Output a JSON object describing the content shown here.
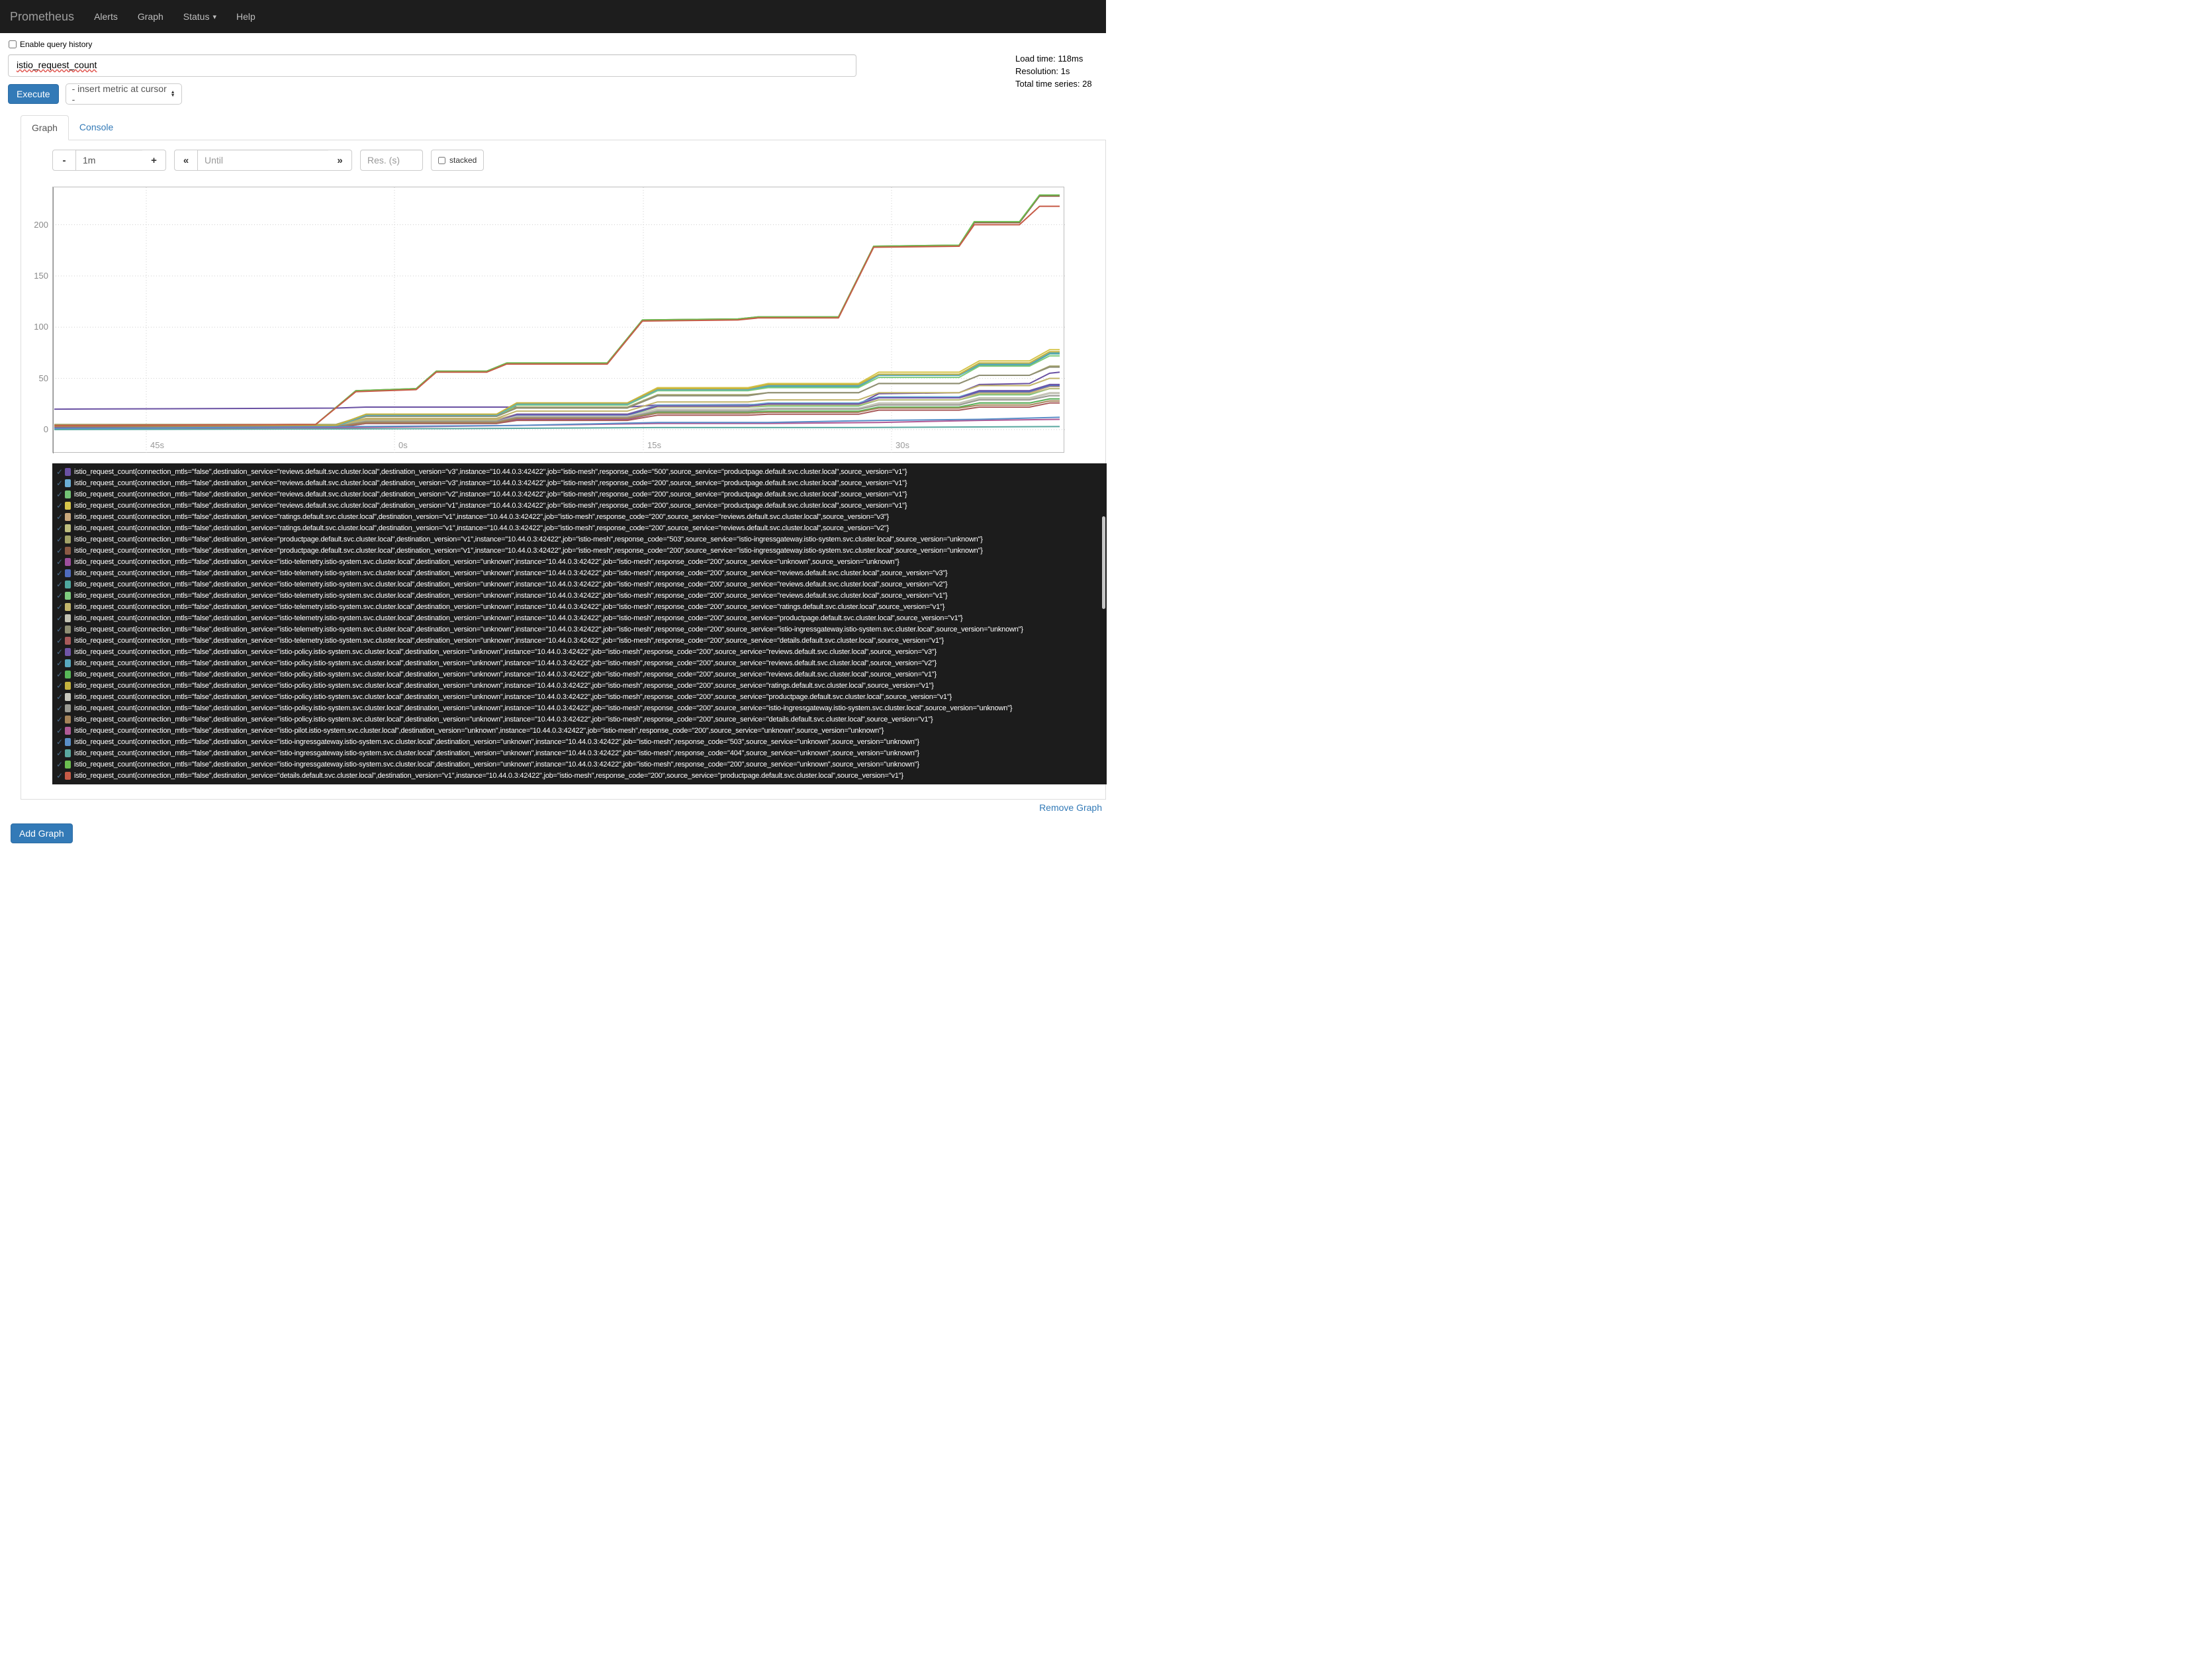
{
  "navbar": {
    "brand": "Prometheus",
    "items": [
      {
        "label": "Alerts"
      },
      {
        "label": "Graph"
      },
      {
        "label": "Status"
      },
      {
        "label": "Help"
      }
    ]
  },
  "query_history": {
    "label": "Enable query history"
  },
  "query": {
    "value": "istio_request_count"
  },
  "stats": {
    "load_time": "Load time: 118ms",
    "resolution": "Resolution: 1s",
    "total_series": "Total time series: 28"
  },
  "actions": {
    "execute": "Execute",
    "insert_metric": "- insert metric at cursor -"
  },
  "tabs": [
    {
      "label": "Graph"
    },
    {
      "label": "Console"
    }
  ],
  "controls": {
    "minus": "-",
    "duration": "1m",
    "plus": "+",
    "back": "«",
    "until_placeholder": "Until",
    "forward": "»",
    "res_placeholder": "Res. (s)",
    "stacked_label": "stacked"
  },
  "footer": {
    "remove_graph": "Remove Graph",
    "add_graph": "Add Graph"
  },
  "chart_data": {
    "type": "line",
    "metric": "istio_request_count",
    "x_tick_labels": [
      "45s",
      "0s",
      "15s",
      "30s"
    ],
    "y_ticks": [
      0,
      50,
      100,
      150,
      200
    ],
    "ylim": [
      0,
      245
    ],
    "grid": true,
    "legend_position": "bottom",
    "common_labels": {
      "connection_mtls": "false",
      "instance": "10.44.0.3:42422",
      "job": "istio-mesh"
    },
    "step_times": [
      0,
      0.28,
      0.31,
      0.44,
      0.46,
      0.57,
      0.6,
      0.69,
      0.71,
      0.8,
      0.82,
      0.9,
      0.92,
      0.97,
      0.99,
      1
    ],
    "series": [
      {
        "color": "#6a51a3",
        "destination_service": "reviews.default.svc.cluster.local",
        "destination_version": "v3",
        "response_code": "500",
        "source_service": "productpage.default.svc.cluster.local",
        "source_version": "v1",
        "points": [
          [
            0,
            20
          ],
          [
            0.28,
            21
          ],
          [
            0.31,
            22
          ],
          [
            0.57,
            22
          ],
          [
            0.6,
            24
          ],
          [
            0.8,
            25
          ],
          [
            0.82,
            35
          ],
          [
            0.9,
            36
          ],
          [
            0.92,
            44
          ],
          [
            0.97,
            45
          ],
          [
            0.99,
            55
          ],
          [
            1,
            56
          ]
        ]
      },
      {
        "color": "#6baed6",
        "destination_service": "reviews.default.svc.cluster.local",
        "destination_version": "v3",
        "response_code": "200",
        "source_service": "productpage.default.svc.cluster.local",
        "source_version": "v1",
        "steps": [
          3,
          9,
          15,
          24,
          26,
          32,
          38,
          44
        ]
      },
      {
        "color": "#74c476",
        "destination_service": "reviews.default.svc.cluster.local",
        "destination_version": "v2",
        "response_code": "200",
        "source_service": "productpage.default.svc.cluster.local",
        "source_version": "v1",
        "steps": [
          3,
          9,
          14,
          22,
          23,
          29,
          34,
          40
        ]
      },
      {
        "color": "#d6c54a",
        "destination_service": "reviews.default.svc.cluster.local",
        "destination_version": "v1",
        "response_code": "200",
        "source_service": "productpage.default.svc.cluster.local",
        "source_version": "v1",
        "steps": [
          4,
          15,
          26,
          41,
          45,
          56,
          67,
          78
        ]
      },
      {
        "color": "#c9a87c",
        "destination_service": "ratings.default.svc.cluster.local",
        "destination_version": "v1",
        "response_code": "200",
        "source_service": "reviews.default.svc.cluster.local",
        "source_version": "v3",
        "steps": [
          4,
          10,
          15,
          23,
          25,
          31,
          36,
          42
        ]
      },
      {
        "color": "#bdbd7e",
        "destination_service": "ratings.default.svc.cluster.local",
        "destination_version": "v1",
        "response_code": "200",
        "source_service": "reviews.default.svc.cluster.local",
        "source_version": "v2",
        "steps": [
          4,
          9,
          15,
          22,
          24,
          29,
          35,
          40
        ]
      },
      {
        "color": "#a3a368",
        "destination_service": "productpage.default.svc.cluster.local",
        "destination_version": "v1",
        "response_code": "503",
        "source_service": "istio-ingressgateway.istio-system.svc.cluster.local",
        "source_version": "unknown",
        "steps": [
          5,
          14,
          22,
          34,
          36,
          45,
          53,
          62
        ]
      },
      {
        "color": "#8c5a44",
        "destination_service": "productpage.default.svc.cluster.local",
        "destination_version": "v1",
        "response_code": "200",
        "source_service": "istio-ingressgateway.istio-system.svc.cluster.local",
        "source_version": "unknown",
        "points": [
          [
            0,
            4
          ],
          [
            0.26,
            5
          ],
          [
            0.3,
            38
          ],
          [
            0.36,
            40
          ],
          [
            0.38,
            57
          ],
          [
            0.43,
            57
          ],
          [
            0.45,
            65
          ],
          [
            0.55,
            65
          ],
          [
            0.585,
            107
          ],
          [
            0.68,
            108
          ],
          [
            0.7,
            110
          ],
          [
            0.78,
            110
          ],
          [
            0.815,
            179
          ],
          [
            0.9,
            180
          ],
          [
            0.915,
            202
          ],
          [
            0.96,
            202
          ],
          [
            0.98,
            228
          ],
          [
            1,
            228
          ]
        ]
      },
      {
        "color": "#9e4f9e",
        "destination_service": "istio-telemetry.istio-system.svc.cluster.local",
        "destination_version": "unknown",
        "response_code": "200",
        "source_service": "unknown",
        "source_version": "unknown",
        "steps": [
          2,
          6,
          10,
          16,
          17,
          22,
          26,
          30
        ]
      },
      {
        "color": "#4f6bbe",
        "destination_service": "istio-telemetry.istio-system.svc.cluster.local",
        "destination_version": "unknown",
        "response_code": "200",
        "source_service": "reviews.default.svc.cluster.local",
        "source_version": "v3",
        "steps": [
          3,
          8,
          14,
          23,
          25,
          31,
          37,
          43
        ]
      },
      {
        "color": "#4fa8a0",
        "destination_service": "istio-telemetry.istio-system.svc.cluster.local",
        "destination_version": "unknown",
        "response_code": "200",
        "source_service": "reviews.default.svc.cluster.local",
        "source_version": "v2",
        "steps": [
          3,
          14,
          24,
          39,
          42,
          53,
          63,
          74
        ]
      },
      {
        "color": "#7ecb7e",
        "destination_service": "istio-telemetry.istio-system.svc.cluster.local",
        "destination_version": "unknown",
        "response_code": "200",
        "source_service": "reviews.default.svc.cluster.local",
        "source_version": "v1",
        "steps": [
          3,
          13,
          24,
          38,
          41,
          51,
          62,
          72
        ]
      },
      {
        "color": "#c2b56b",
        "destination_service": "istio-telemetry.istio-system.svc.cluster.local",
        "destination_version": "unknown",
        "response_code": "200",
        "source_service": "ratings.default.svc.cluster.local",
        "source_version": "v1",
        "steps": [
          4,
          11,
          18,
          27,
          29,
          36,
          43,
          50
        ]
      },
      {
        "color": "#c3c3b4",
        "destination_service": "istio-telemetry.istio-system.svc.cluster.local",
        "destination_version": "unknown",
        "response_code": "200",
        "source_service": "productpage.default.svc.cluster.local",
        "source_version": "v1",
        "steps": [
          3,
          8,
          13,
          20,
          21,
          26,
          31,
          36
        ]
      },
      {
        "color": "#8f8f74",
        "destination_service": "istio-telemetry.istio-system.svc.cluster.local",
        "destination_version": "unknown",
        "response_code": "200",
        "source_service": "istio-ingressgateway.istio-system.svc.cluster.local",
        "source_version": "unknown",
        "steps": [
          4,
          13,
          21,
          33,
          36,
          45,
          53,
          61
        ]
      },
      {
        "color": "#a85a5a",
        "destination_service": "istio-telemetry.istio-system.svc.cluster.local",
        "destination_version": "unknown",
        "response_code": "200",
        "source_service": "details.default.svc.cluster.local",
        "source_version": "v1",
        "steps": [
          2,
          6,
          9,
          14,
          15,
          19,
          22,
          26
        ]
      },
      {
        "color": "#7055a8",
        "destination_service": "istio-policy.istio-system.svc.cluster.local",
        "destination_version": "unknown",
        "response_code": "200",
        "source_service": "reviews.default.svc.cluster.local",
        "source_version": "v3",
        "steps": [
          2,
          8,
          15,
          23,
          25,
          31,
          38,
          44
        ]
      },
      {
        "color": "#58a8c0",
        "destination_service": "istio-policy.istio-system.svc.cluster.local",
        "destination_version": "unknown",
        "response_code": "200",
        "source_service": "reviews.default.svc.cluster.local",
        "source_version": "v2",
        "steps": [
          3,
          14,
          25,
          39,
          43,
          53,
          64,
          75
        ]
      },
      {
        "color": "#58b858",
        "destination_service": "istio-policy.istio-system.svc.cluster.local",
        "destination_version": "unknown",
        "response_code": "200",
        "source_service": "reviews.default.svc.cluster.local",
        "source_version": "v1",
        "steps": [
          3,
          7,
          11,
          17,
          18,
          22,
          26,
          30
        ]
      },
      {
        "color": "#c4b23e",
        "destination_service": "istio-policy.istio-system.svc.cluster.local",
        "destination_version": "unknown",
        "response_code": "200",
        "source_service": "ratings.default.svc.cluster.local",
        "source_version": "v1",
        "steps": [
          4,
          15,
          26,
          40,
          44,
          54,
          65,
          76
        ]
      },
      {
        "color": "#c8c8be",
        "destination_service": "istio-policy.istio-system.svc.cluster.local",
        "destination_version": "unknown",
        "response_code": "200",
        "source_service": "productpage.default.svc.cluster.local",
        "source_version": "v1",
        "steps": [
          3,
          8,
          13,
          19,
          21,
          25,
          30,
          35
        ]
      },
      {
        "color": "#9a9a92",
        "destination_service": "istio-policy.istio-system.svc.cluster.local",
        "destination_version": "unknown",
        "response_code": "200",
        "source_service": "istio-ingressgateway.istio-system.svc.cluster.local",
        "source_version": "unknown",
        "steps": [
          3,
          8,
          12,
          18,
          20,
          24,
          29,
          33
        ]
      },
      {
        "color": "#a58358",
        "destination_service": "istio-policy.istio-system.svc.cluster.local",
        "destination_version": "unknown",
        "response_code": "200",
        "source_service": "details.default.svc.cluster.local",
        "source_version": "v1",
        "steps": [
          3,
          7,
          11,
          16,
          17,
          21,
          24,
          28
        ]
      },
      {
        "color": "#b05a96",
        "destination_service": "istio-pilot.istio-system.svc.cluster.local",
        "destination_version": "unknown",
        "response_code": "200",
        "source_service": "unknown",
        "source_version": "unknown",
        "points": [
          [
            0,
            1
          ],
          [
            0.3,
            2
          ],
          [
            0.46,
            4
          ],
          [
            0.6,
            6
          ],
          [
            0.71,
            6
          ],
          [
            0.82,
            7
          ],
          [
            0.92,
            9
          ],
          [
            1,
            10
          ]
        ]
      },
      {
        "color": "#5a8fc8",
        "destination_service": "istio-ingressgateway.istio-system.svc.cluster.local",
        "destination_version": "unknown",
        "response_code": "503",
        "source_service": "unknown",
        "source_version": "unknown",
        "points": [
          [
            0,
            1
          ],
          [
            0.3,
            3
          ],
          [
            0.46,
            4
          ],
          [
            0.6,
            7
          ],
          [
            0.71,
            7
          ],
          [
            0.82,
            9
          ],
          [
            0.92,
            10
          ],
          [
            1,
            12
          ]
        ]
      },
      {
        "color": "#5aa8a0",
        "destination_service": "istio-ingressgateway.istio-system.svc.cluster.local",
        "destination_version": "unknown",
        "response_code": "404",
        "source_service": "unknown",
        "source_version": "unknown",
        "points": [
          [
            0,
            0
          ],
          [
            0.4,
            1
          ],
          [
            0.6,
            2
          ],
          [
            0.8,
            2
          ],
          [
            1,
            3
          ]
        ]
      },
      {
        "color": "#6cbe50",
        "destination_service": "istio-ingressgateway.istio-system.svc.cluster.local",
        "destination_version": "unknown",
        "response_code": "200",
        "source_service": "unknown",
        "source_version": "unknown",
        "points": [
          [
            0,
            4
          ],
          [
            0.26,
            5
          ],
          [
            0.3,
            38
          ],
          [
            0.36,
            40
          ],
          [
            0.38,
            57
          ],
          [
            0.43,
            57
          ],
          [
            0.45,
            65
          ],
          [
            0.55,
            65
          ],
          [
            0.585,
            107
          ],
          [
            0.68,
            108
          ],
          [
            0.7,
            110
          ],
          [
            0.78,
            110
          ],
          [
            0.815,
            179
          ],
          [
            0.9,
            180
          ],
          [
            0.915,
            203
          ],
          [
            0.96,
            203
          ],
          [
            0.98,
            229
          ],
          [
            1,
            229
          ]
        ]
      },
      {
        "color": "#c65b47",
        "destination_service": "details.default.svc.cluster.local",
        "destination_version": "v1",
        "response_code": "200",
        "source_service": "productpage.default.svc.cluster.local",
        "source_version": "v1",
        "points": [
          [
            0,
            4
          ],
          [
            0.26,
            5
          ],
          [
            0.3,
            37
          ],
          [
            0.36,
            39
          ],
          [
            0.38,
            56
          ],
          [
            0.43,
            56
          ],
          [
            0.45,
            64
          ],
          [
            0.55,
            64
          ],
          [
            0.585,
            106
          ],
          [
            0.68,
            107
          ],
          [
            0.7,
            109
          ],
          [
            0.78,
            109
          ],
          [
            0.815,
            178
          ],
          [
            0.9,
            179
          ],
          [
            0.915,
            200
          ],
          [
            0.96,
            200
          ],
          [
            0.98,
            218
          ],
          [
            1,
            218
          ]
        ]
      }
    ]
  }
}
